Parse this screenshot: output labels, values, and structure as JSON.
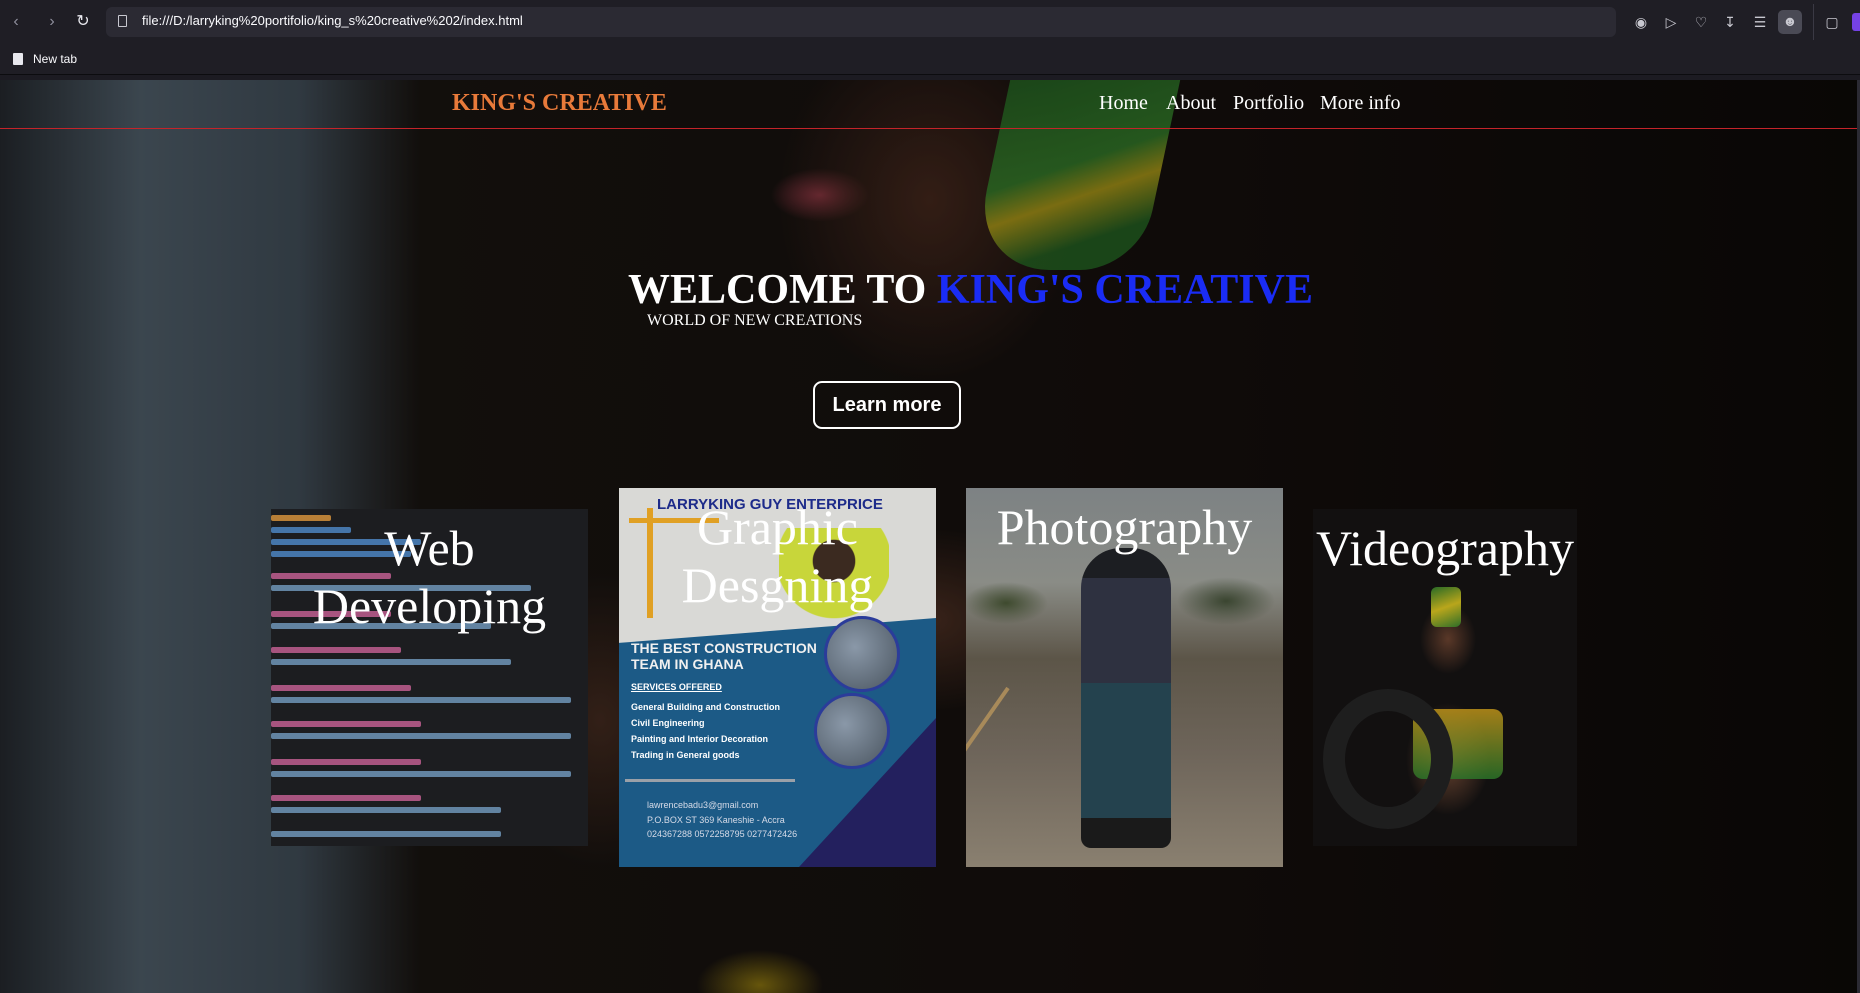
{
  "browser": {
    "url": "file:///D:/larryking%20portifolio/king_s%20creative%202/index.html",
    "bookmark_label": "New tab",
    "accent_color": "#7542e5"
  },
  "site": {
    "brand": "KING'S CREATIVE",
    "brand_color": "#e87a3a",
    "nav": [
      "Home",
      "About",
      "Portfolio",
      "More info"
    ],
    "hero": {
      "title_prefix": "WELCOME TO ",
      "title_accent": "KING'S CREATIVE",
      "accent_color": "#1a2cf5",
      "subtitle": "WORLD OF NEW CREATIONS",
      "cta": "Learn more"
    },
    "cards": [
      {
        "title": "Web Developing"
      },
      {
        "title": "Graphic Desgning"
      },
      {
        "title": "Photography"
      },
      {
        "title": "Videography"
      }
    ],
    "flyer": {
      "company": "LARRYKING GUY ENTERPRICE",
      "tagline_1": "THE BEST CONSTRUCTION",
      "tagline_2": "TEAM IN GHANA",
      "services_heading": "SERVICES OFFERED",
      "services": [
        "General Building and Construction",
        "Civil Engineering",
        "Painting and Interior Decoration",
        "Trading in General goods"
      ],
      "email": "lawrencebadu3@gmail.com",
      "address": "P.O.BOX ST 369 Kaneshie - Accra",
      "phones": "024367288 0572258795 0277472426"
    }
  }
}
